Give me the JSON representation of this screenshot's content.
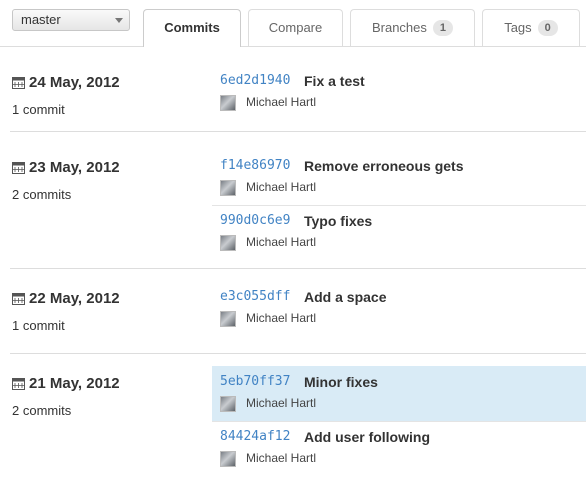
{
  "branch": {
    "label": "master"
  },
  "tabs": [
    {
      "label": "Commits"
    },
    {
      "label": "Compare"
    },
    {
      "label": "Branches",
      "count": "1"
    },
    {
      "label": "Tags",
      "count": "0"
    }
  ],
  "days": [
    {
      "date": "24 May, 2012",
      "count": "1 commit",
      "commits": [
        {
          "sha": "6ed2d1940",
          "message": "Fix a test",
          "author": "Michael Hartl"
        }
      ]
    },
    {
      "date": "23 May, 2012",
      "count": "2 commits",
      "commits": [
        {
          "sha": "f14e86970",
          "message": "Remove erroneous gets",
          "author": "Michael Hartl"
        },
        {
          "sha": "990d0c6e9",
          "message": "Typo fixes",
          "author": "Michael Hartl"
        }
      ]
    },
    {
      "date": "22 May, 2012",
      "count": "1 commit",
      "commits": [
        {
          "sha": "e3c055dff",
          "message": "Add a space",
          "author": "Michael Hartl"
        }
      ]
    },
    {
      "date": "21 May, 2012",
      "count": "2 commits",
      "commits": [
        {
          "sha": "5eb70ff37",
          "message": "Minor fixes",
          "author": "Michael Hartl"
        },
        {
          "sha": "84424af12",
          "message": "Add user following",
          "author": "Michael Hartl"
        }
      ]
    }
  ],
  "colors": {
    "link": "#4183c4",
    "highlight": "#d9ebf6"
  }
}
